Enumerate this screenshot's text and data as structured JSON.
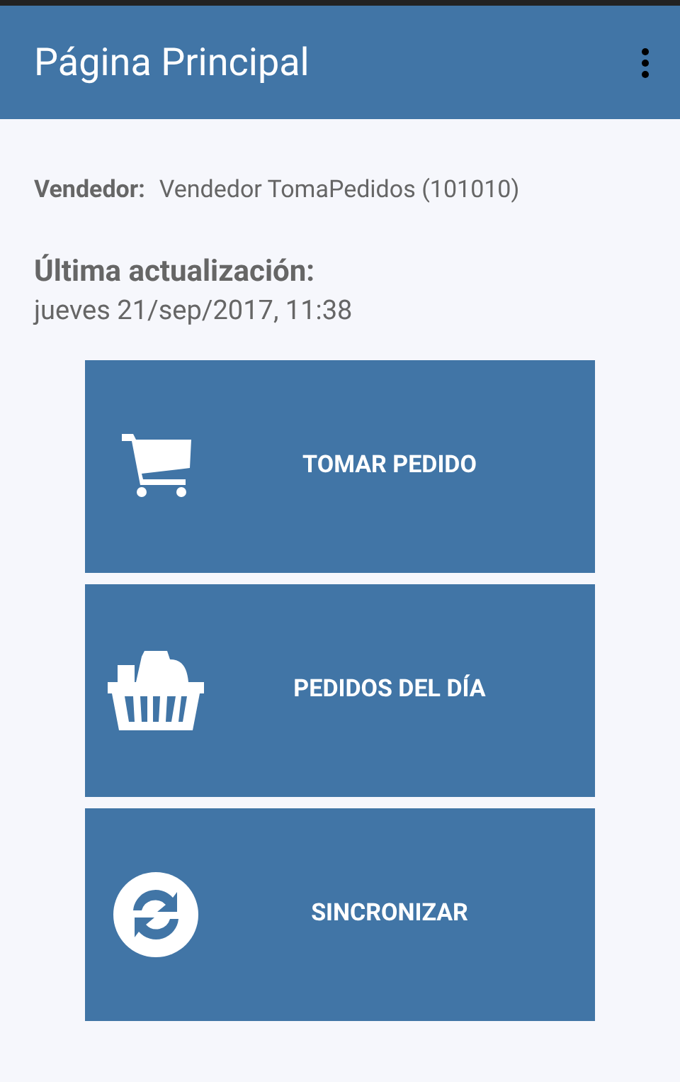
{
  "app_bar": {
    "title": "Página Principal"
  },
  "seller": {
    "label": "Vendedor:",
    "value": "Vendedor TomaPedidos (101010)"
  },
  "last_update": {
    "label": "Última actualización:",
    "value": "jueves 21/sep/2017, 11:38"
  },
  "actions": [
    {
      "kind": "cart",
      "label": "TOMAR PEDIDO"
    },
    {
      "kind": "basket",
      "label": "PEDIDOS DEL DÍA"
    },
    {
      "kind": "sync",
      "label": "SINCRONIZAR"
    }
  ]
}
